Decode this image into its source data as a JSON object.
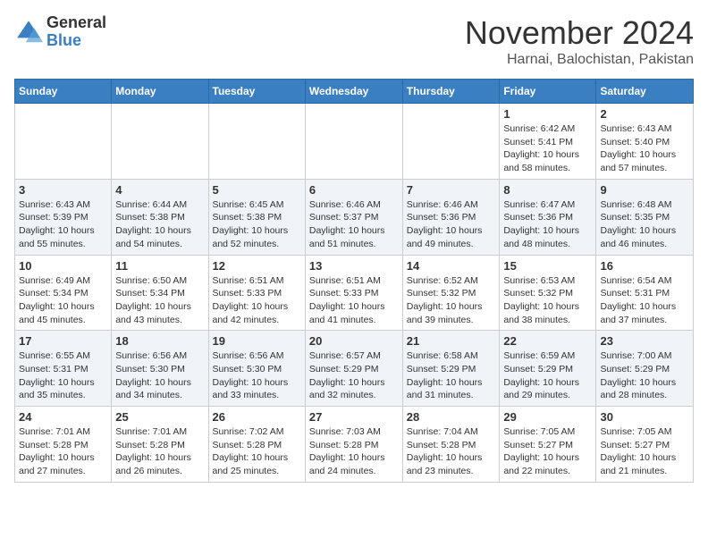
{
  "logo": {
    "general": "General",
    "blue": "Blue"
  },
  "header": {
    "month": "November 2024",
    "location": "Harnai, Balochistan, Pakistan"
  },
  "weekdays": [
    "Sunday",
    "Monday",
    "Tuesday",
    "Wednesday",
    "Thursday",
    "Friday",
    "Saturday"
  ],
  "weeks": [
    [
      {
        "day": "",
        "info": ""
      },
      {
        "day": "",
        "info": ""
      },
      {
        "day": "",
        "info": ""
      },
      {
        "day": "",
        "info": ""
      },
      {
        "day": "",
        "info": ""
      },
      {
        "day": "1",
        "info": "Sunrise: 6:42 AM\nSunset: 5:41 PM\nDaylight: 10 hours and 58 minutes."
      },
      {
        "day": "2",
        "info": "Sunrise: 6:43 AM\nSunset: 5:40 PM\nDaylight: 10 hours and 57 minutes."
      }
    ],
    [
      {
        "day": "3",
        "info": "Sunrise: 6:43 AM\nSunset: 5:39 PM\nDaylight: 10 hours and 55 minutes."
      },
      {
        "day": "4",
        "info": "Sunrise: 6:44 AM\nSunset: 5:38 PM\nDaylight: 10 hours and 54 minutes."
      },
      {
        "day": "5",
        "info": "Sunrise: 6:45 AM\nSunset: 5:38 PM\nDaylight: 10 hours and 52 minutes."
      },
      {
        "day": "6",
        "info": "Sunrise: 6:46 AM\nSunset: 5:37 PM\nDaylight: 10 hours and 51 minutes."
      },
      {
        "day": "7",
        "info": "Sunrise: 6:46 AM\nSunset: 5:36 PM\nDaylight: 10 hours and 49 minutes."
      },
      {
        "day": "8",
        "info": "Sunrise: 6:47 AM\nSunset: 5:36 PM\nDaylight: 10 hours and 48 minutes."
      },
      {
        "day": "9",
        "info": "Sunrise: 6:48 AM\nSunset: 5:35 PM\nDaylight: 10 hours and 46 minutes."
      }
    ],
    [
      {
        "day": "10",
        "info": "Sunrise: 6:49 AM\nSunset: 5:34 PM\nDaylight: 10 hours and 45 minutes."
      },
      {
        "day": "11",
        "info": "Sunrise: 6:50 AM\nSunset: 5:34 PM\nDaylight: 10 hours and 43 minutes."
      },
      {
        "day": "12",
        "info": "Sunrise: 6:51 AM\nSunset: 5:33 PM\nDaylight: 10 hours and 42 minutes."
      },
      {
        "day": "13",
        "info": "Sunrise: 6:51 AM\nSunset: 5:33 PM\nDaylight: 10 hours and 41 minutes."
      },
      {
        "day": "14",
        "info": "Sunrise: 6:52 AM\nSunset: 5:32 PM\nDaylight: 10 hours and 39 minutes."
      },
      {
        "day": "15",
        "info": "Sunrise: 6:53 AM\nSunset: 5:32 PM\nDaylight: 10 hours and 38 minutes."
      },
      {
        "day": "16",
        "info": "Sunrise: 6:54 AM\nSunset: 5:31 PM\nDaylight: 10 hours and 37 minutes."
      }
    ],
    [
      {
        "day": "17",
        "info": "Sunrise: 6:55 AM\nSunset: 5:31 PM\nDaylight: 10 hours and 35 minutes."
      },
      {
        "day": "18",
        "info": "Sunrise: 6:56 AM\nSunset: 5:30 PM\nDaylight: 10 hours and 34 minutes."
      },
      {
        "day": "19",
        "info": "Sunrise: 6:56 AM\nSunset: 5:30 PM\nDaylight: 10 hours and 33 minutes."
      },
      {
        "day": "20",
        "info": "Sunrise: 6:57 AM\nSunset: 5:29 PM\nDaylight: 10 hours and 32 minutes."
      },
      {
        "day": "21",
        "info": "Sunrise: 6:58 AM\nSunset: 5:29 PM\nDaylight: 10 hours and 31 minutes."
      },
      {
        "day": "22",
        "info": "Sunrise: 6:59 AM\nSunset: 5:29 PM\nDaylight: 10 hours and 29 minutes."
      },
      {
        "day": "23",
        "info": "Sunrise: 7:00 AM\nSunset: 5:29 PM\nDaylight: 10 hours and 28 minutes."
      }
    ],
    [
      {
        "day": "24",
        "info": "Sunrise: 7:01 AM\nSunset: 5:28 PM\nDaylight: 10 hours and 27 minutes."
      },
      {
        "day": "25",
        "info": "Sunrise: 7:01 AM\nSunset: 5:28 PM\nDaylight: 10 hours and 26 minutes."
      },
      {
        "day": "26",
        "info": "Sunrise: 7:02 AM\nSunset: 5:28 PM\nDaylight: 10 hours and 25 minutes."
      },
      {
        "day": "27",
        "info": "Sunrise: 7:03 AM\nSunset: 5:28 PM\nDaylight: 10 hours and 24 minutes."
      },
      {
        "day": "28",
        "info": "Sunrise: 7:04 AM\nSunset: 5:28 PM\nDaylight: 10 hours and 23 minutes."
      },
      {
        "day": "29",
        "info": "Sunrise: 7:05 AM\nSunset: 5:27 PM\nDaylight: 10 hours and 22 minutes."
      },
      {
        "day": "30",
        "info": "Sunrise: 7:05 AM\nSunset: 5:27 PM\nDaylight: 10 hours and 21 minutes."
      }
    ]
  ]
}
